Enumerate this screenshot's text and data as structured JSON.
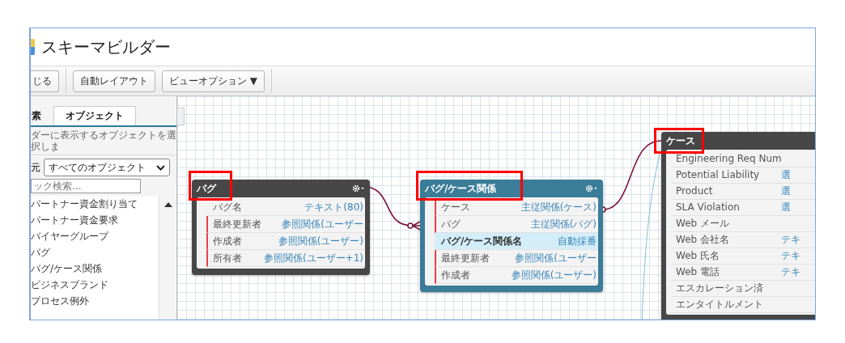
{
  "window": {
    "title": "スキーマビルダー"
  },
  "toolbar": {
    "buttons": [
      {
        "label": "じる"
      },
      {
        "label": "自動レイアウト"
      },
      {
        "label": "ビューオプション ▼"
      }
    ]
  },
  "sidebar": {
    "tabs": [
      {
        "label": "素",
        "selected": false
      },
      {
        "label": "オブジェクト",
        "selected": true
      }
    ],
    "description": "ダーに表示するオブジェクトを選択しま",
    "filter_label": "元",
    "filter_value": "すべてのオブジェクト",
    "search": {
      "placeholder": "ック検索..."
    },
    "items": [
      "パートナー資金割り当て",
      "パートナー資金要求",
      "バイヤーグループ",
      "バグ",
      "バグ/ケース関係",
      "ビジネスブランド",
      "プロセス例外"
    ]
  },
  "canvas": {
    "nodes": [
      {
        "title": "バグ",
        "kind": "object",
        "highlighted": true,
        "gear": true,
        "fields": [
          {
            "label": "バグ名",
            "type": "テキスト(80)",
            "required": false,
            "selected": false
          },
          {
            "label": "最終更新者",
            "type": "参照関係(ユーザー",
            "required": true,
            "selected": false
          },
          {
            "label": "作成者",
            "type": "参照関係(ユーザー)",
            "required": true,
            "selected": false
          },
          {
            "label": "所有者",
            "type": "参照関係(ユーザー+1)",
            "required": true,
            "selected": false
          }
        ]
      },
      {
        "title": "バグ/ケース関係",
        "kind": "junction",
        "highlighted": true,
        "gear": true,
        "fields": [
          {
            "label": "ケース",
            "type": "主従関係(ケース)",
            "required": true,
            "selected": false
          },
          {
            "label": "バグ",
            "type": "主従関係(バグ)",
            "required": true,
            "selected": false
          },
          {
            "label": "バグ/ケース関係名",
            "type": "自動採番",
            "required": false,
            "selected": true
          },
          {
            "label": "最終更新者",
            "type": "参照関係(ユーザー",
            "required": true,
            "selected": false
          },
          {
            "label": "作成者",
            "type": "参照関係(ユーザー)",
            "required": true,
            "selected": false
          }
        ]
      },
      {
        "title": "ケース",
        "kind": "object",
        "highlighted": true,
        "gear": false,
        "fields": [
          {
            "label": "Engineering Req Num",
            "required": false,
            "selected": false
          },
          {
            "label": "Potential Liability",
            "type": "選",
            "required": false,
            "selected": false
          },
          {
            "label": "Product",
            "type": "選",
            "required": false,
            "selected": false
          },
          {
            "label": "SLA Violation",
            "type": "選",
            "required": false,
            "selected": false
          },
          {
            "label": "Web メール",
            "required": false,
            "selected": false
          },
          {
            "label": "Web 会社名",
            "type": "テキ",
            "required": false,
            "selected": false
          },
          {
            "label": "Web 氏名",
            "type": "テキ",
            "required": false,
            "selected": false
          },
          {
            "label": "Web 電話",
            "type": "テキ",
            "required": false,
            "selected": false
          },
          {
            "label": "エスカレーション済",
            "required": false,
            "selected": false
          },
          {
            "label": "エンタイトルメント",
            "required": false,
            "selected": false
          }
        ]
      }
    ]
  }
}
